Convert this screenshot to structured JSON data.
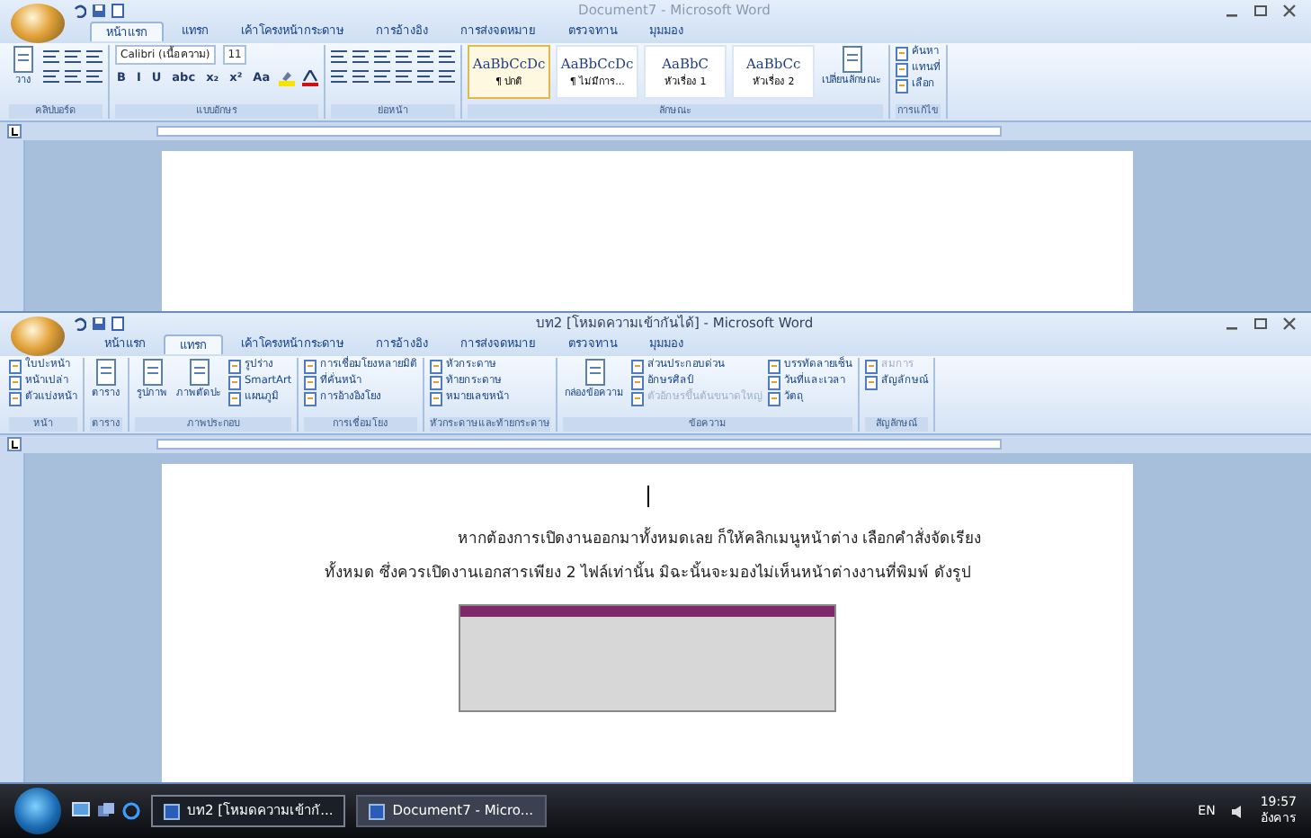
{
  "windows": [
    {
      "title": "Document7 - Microsoft Word",
      "active": false,
      "tabs": [
        {
          "label": "หน้าแรก",
          "selected": true
        },
        {
          "label": "แทรก",
          "selected": false
        },
        {
          "label": "เค้าโครงหน้ากระดาษ",
          "selected": false
        },
        {
          "label": "การอ้างอิง",
          "selected": false
        },
        {
          "label": "การส่งจดหมาย",
          "selected": false
        },
        {
          "label": "ตรวจทาน",
          "selected": false
        },
        {
          "label": "มุมมอง",
          "selected": false
        }
      ],
      "groups": [
        {
          "label": "คลิปบอร์ด",
          "columns": [
            {
              "kind": "big",
              "label": "วาง"
            },
            {
              "kind": "icons"
            }
          ]
        },
        {
          "label": "แบบอักษร",
          "columns": [
            {
              "kind": "font",
              "font": "Calibri (เนื้อความ)",
              "size": "11",
              "glyphs": [
                "B",
                "I",
                "U",
                "abc",
                "x₂",
                "x²",
                "Aa"
              ]
            }
          ]
        },
        {
          "label": "ย่อหน้า",
          "columns": [
            {
              "kind": "icons"
            },
            {
              "kind": "icons"
            }
          ]
        },
        {
          "label": "ลักษณะ",
          "columns": [
            {
              "kind": "style",
              "sample": "AaBbCcDc",
              "label": "¶ ปกติ",
              "selected": true
            },
            {
              "kind": "style",
              "sample": "AaBbCcDc",
              "label": "¶ ไม่มีการ...",
              "selected": false
            },
            {
              "kind": "style",
              "sample": "AaBbC",
              "label": "หัวเรื่อง 1",
              "selected": false
            },
            {
              "kind": "style",
              "sample": "AaBbCc",
              "label": "หัวเรื่อง 2",
              "selected": false
            },
            {
              "kind": "big",
              "label": "เปลี่ยนลักษณะ"
            }
          ]
        },
        {
          "label": "การแก้ไข",
          "columns": [
            {
              "kind": "stack",
              "items": [
                {
                  "label": "ค้นหา",
                  "disabled": false
                },
                {
                  "label": "แทนที่",
                  "disabled": false
                },
                {
                  "label": "เลือก",
                  "disabled": false
                }
              ]
            }
          ]
        }
      ]
    },
    {
      "title": "บท2 [โหมดความเข้ากันได้] - Microsoft Word",
      "active": true,
      "tabs": [
        {
          "label": "หน้าแรก",
          "selected": false
        },
        {
          "label": "แทรก",
          "selected": true
        },
        {
          "label": "เค้าโครงหน้ากระดาษ",
          "selected": false
        },
        {
          "label": "การอ้างอิง",
          "selected": false
        },
        {
          "label": "การส่งจดหมาย",
          "selected": false
        },
        {
          "label": "ตรวจทาน",
          "selected": false
        },
        {
          "label": "มุมมอง",
          "selected": false
        }
      ],
      "groups": [
        {
          "label": "หน้า",
          "columns": [
            {
              "kind": "stack",
              "items": [
                {
                  "label": "ใบปะหน้า",
                  "disabled": false
                },
                {
                  "label": "หน้าเปล่า",
                  "disabled": false
                },
                {
                  "label": "ตัวแบ่งหน้า",
                  "disabled": false
                }
              ]
            }
          ]
        },
        {
          "label": "ตาราง",
          "columns": [
            {
              "kind": "big",
              "label": "ตาราง"
            }
          ]
        },
        {
          "label": "ภาพประกอบ",
          "columns": [
            {
              "kind": "big",
              "label": "รูปภาพ"
            },
            {
              "kind": "big",
              "label": "ภาพตัดปะ"
            },
            {
              "kind": "stack",
              "items": [
                {
                  "label": "รูปร่าง",
                  "disabled": false
                },
                {
                  "label": "SmartArt",
                  "disabled": false
                },
                {
                  "label": "แผนภูมิ",
                  "disabled": false
                }
              ]
            }
          ]
        },
        {
          "label": "การเชื่อมโยง",
          "columns": [
            {
              "kind": "stack",
              "items": [
                {
                  "label": "การเชื่อมโยงหลายมิติ",
                  "disabled": false
                },
                {
                  "label": "ที่คั่นหน้า",
                  "disabled": false
                },
                {
                  "label": "การอ้างอิงโยง",
                  "disabled": false
                }
              ]
            }
          ]
        },
        {
          "label": "หัวกระดาษและท้ายกระดาษ",
          "columns": [
            {
              "kind": "stack",
              "items": [
                {
                  "label": "หัวกระดาษ",
                  "disabled": false
                },
                {
                  "label": "ท้ายกระดาษ",
                  "disabled": false
                },
                {
                  "label": "หมายเลขหน้า",
                  "disabled": false
                }
              ]
            }
          ]
        },
        {
          "label": "ข้อความ",
          "columns": [
            {
              "kind": "big",
              "label": "กล่องข้อความ"
            },
            {
              "kind": "stack",
              "items": [
                {
                  "label": "ส่วนประกอบด่วน",
                  "disabled": false
                },
                {
                  "label": "อักษรศิลป์",
                  "disabled": false
                },
                {
                  "label": "ตัวอักษรขึ้นต้นขนาดใหญ่",
                  "disabled": true
                }
              ]
            },
            {
              "kind": "stack",
              "items": [
                {
                  "label": "บรรทัดลายเซ็น",
                  "disabled": false
                },
                {
                  "label": "วันที่และเวลา",
                  "disabled": false
                },
                {
                  "label": "วัตถุ",
                  "disabled": false
                }
              ]
            }
          ]
        },
        {
          "label": "สัญลักษณ์",
          "columns": [
            {
              "kind": "stack",
              "items": [
                {
                  "label": "สมการ",
                  "disabled": true
                },
                {
                  "label": "สัญลักษณ์",
                  "disabled": false
                }
              ]
            }
          ]
        }
      ],
      "paragraphs": [
        "หากต้องการเปิดงานออกมาทั้งหมดเลย ก็ให้คลิกเมนูหน้าต่าง เลือกคำสั่งจัดเรียง",
        "ทั้งหมด ซึ่งควรเปิดงานเอกสารเพียง 2 ไฟล์เท่านั้น มิฉะนั้นจะมองไม่เห็นหน้าต่างงานที่พิมพ์ ดังรูป"
      ]
    }
  ],
  "taskbar": {
    "tasks": [
      {
        "label": "บท2 [โหมดความเข้ากั...",
        "selected": true
      },
      {
        "label": "Document7 - Micro...",
        "selected": false
      }
    ],
    "language": "EN",
    "time": "19:57",
    "day": "อังคาร"
  }
}
